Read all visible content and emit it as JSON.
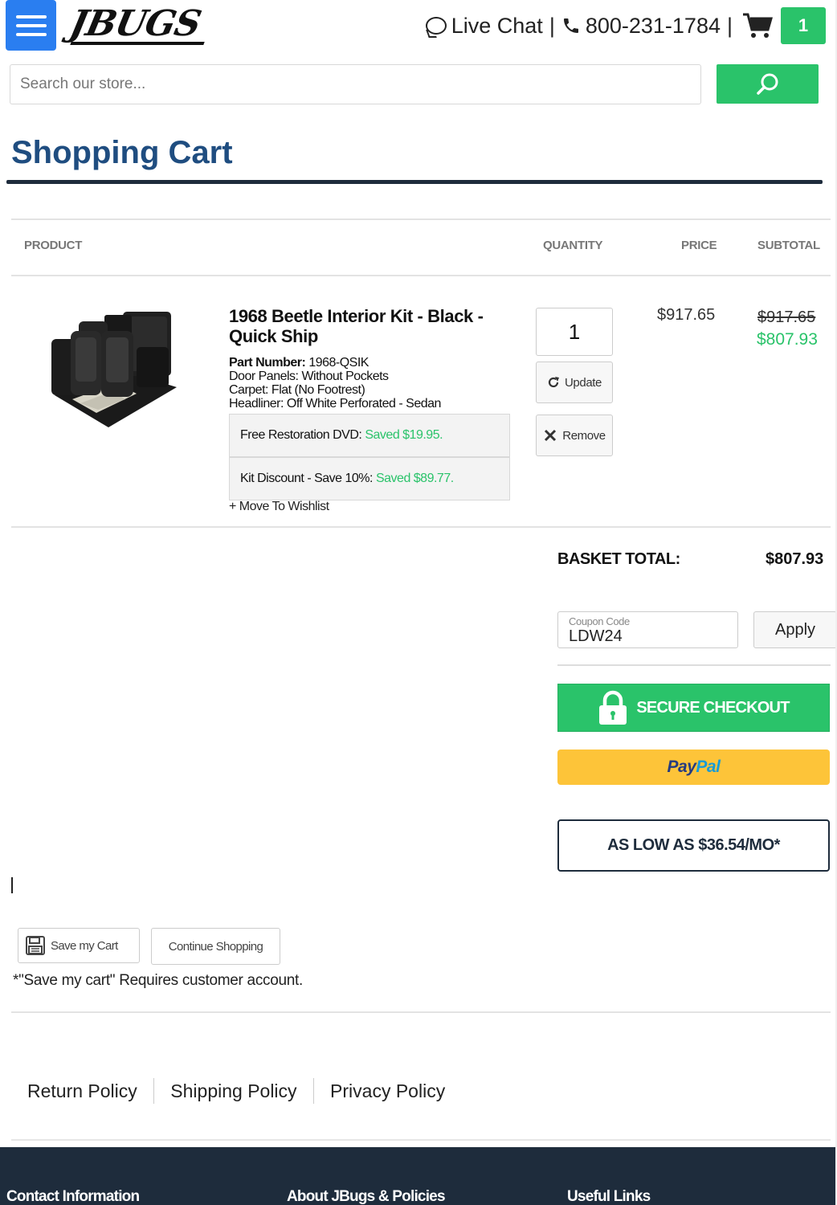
{
  "header": {
    "logo_text": "JBUGS",
    "live_chat": "Live Chat",
    "separator": "|",
    "phone": "800-231-1784",
    "cart_count": "1",
    "icons": [
      "menu-icon",
      "chat-icon",
      "phone-icon",
      "cart-icon",
      "search-icon"
    ]
  },
  "search": {
    "placeholder": "Search our store..."
  },
  "page": {
    "title": "Shopping Cart"
  },
  "table": {
    "headers": {
      "product": "PRODUCT",
      "quantity": "QUANTITY",
      "price": "PRICE",
      "subtotal": "SUBTOTAL"
    }
  },
  "item": {
    "name": "1968 Beetle Interior Kit - Black - Quick Ship",
    "part_number_label": "Part Number:",
    "part_number": "1968-QSIK",
    "options": [
      "Door Panels: Without Pockets",
      "Carpet: Flat (No Footrest)",
      "Headliner: Off White Perforated - Sedan"
    ],
    "promos": [
      {
        "label": "Free Restoration DVD:",
        "saved": "Saved $19.95."
      },
      {
        "label": "Kit Discount - Save 10%:",
        "saved": "Saved $89.77."
      }
    ],
    "wishlist": "+ Move To Wishlist",
    "quantity": "1",
    "update_label": "Update",
    "remove_label": "Remove",
    "price": "$917.65",
    "subtotal_original": "$917.65",
    "subtotal_discounted": "$807.93"
  },
  "totals": {
    "basket_label": "BASKET TOTAL:",
    "basket_value": "$807.93",
    "coupon_label": "Coupon Code",
    "coupon_value": "LDW24",
    "apply_label": "Apply",
    "checkout_label": "SECURE CHECKOUT",
    "paypal_pay": "Pay",
    "paypal_pal": "Pal",
    "financing_label": "AS LOW AS $36.54/MO*"
  },
  "cart_actions": {
    "save_cart": "Save my Cart",
    "continue_shopping": "Continue Shopping",
    "note": "*\"Save my cart\" Requires customer account."
  },
  "policies": [
    "Return Policy",
    "Shipping Policy",
    "Privacy Policy"
  ],
  "footer": {
    "headings": [
      "Contact Information",
      "About JBugs & Policies",
      "Useful Links"
    ]
  },
  "colors": {
    "brand_blue": "#2a7ef0",
    "green": "#2ac36a",
    "navy": "#1e2c3c",
    "title_blue": "#1f4d80",
    "paypal_yellow": "#fdc439"
  }
}
